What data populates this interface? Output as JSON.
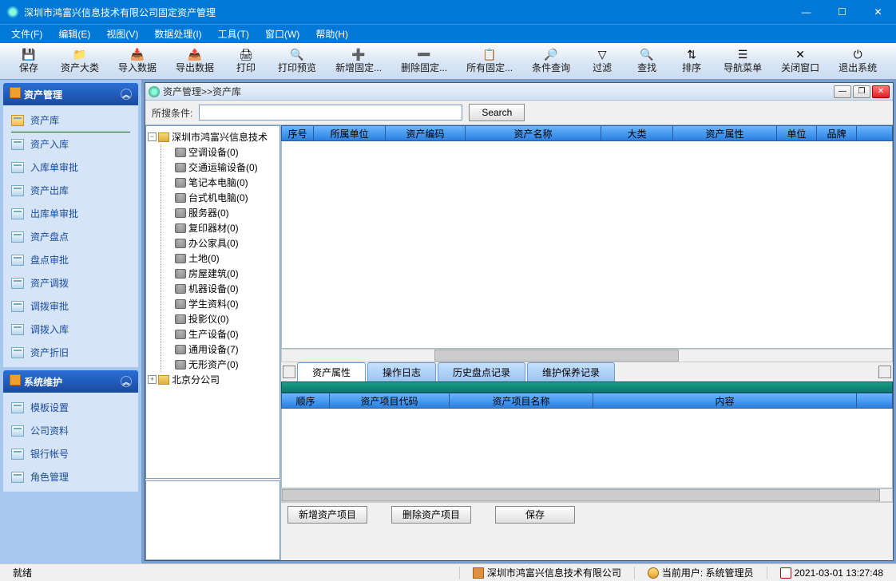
{
  "app": {
    "title": "深圳市鸿富兴信息技术有限公司固定资产管理"
  },
  "menu": [
    "文件(F)",
    "编辑(E)",
    "视图(V)",
    "数据处理(I)",
    "工具(T)",
    "窗口(W)",
    "帮助(H)"
  ],
  "toolbar": [
    {
      "label": "保存",
      "icon": "💾"
    },
    {
      "label": "资产大类",
      "icon": "📁"
    },
    {
      "label": "导入数据",
      "icon": "📥"
    },
    {
      "label": "导出数据",
      "icon": "📤"
    },
    {
      "label": "打印",
      "icon": "🖨"
    },
    {
      "label": "打印预览",
      "icon": "🔍"
    },
    {
      "label": "新增固定...",
      "icon": "➕"
    },
    {
      "label": "删除固定...",
      "icon": "➖"
    },
    {
      "label": "所有固定...",
      "icon": "📋"
    },
    {
      "label": "条件查询",
      "icon": "🔎"
    },
    {
      "label": "过滤",
      "icon": "▽"
    },
    {
      "label": "查找",
      "icon": "🔍"
    },
    {
      "label": "排序",
      "icon": "⇅"
    },
    {
      "label": "导航菜单",
      "icon": "☰"
    },
    {
      "label": "关闭窗口",
      "icon": "✕"
    },
    {
      "label": "退出系统",
      "icon": "⏻"
    }
  ],
  "sidebar": {
    "panels": [
      {
        "title": "资产管理",
        "items": [
          "资产库",
          "资产入库",
          "入库单审批",
          "资产出库",
          "出库单审批",
          "资产盘点",
          "盘点审批",
          "资产调拨",
          "调拨审批",
          "调拨入库",
          "资产折旧"
        ],
        "active": 0
      },
      {
        "title": "系统维护",
        "items": [
          "模板设置",
          "公司资料",
          "银行帐号",
          "角色管理"
        ]
      }
    ]
  },
  "subwindow": {
    "breadcrumb": "资产管理>>资产库",
    "search": {
      "label": "所搜条件:",
      "button": "Search"
    }
  },
  "tree": {
    "root": "深圳市鸿富兴信息技术",
    "children": [
      "空调设备(0)",
      "交通运输设备(0)",
      "笔记本电脑(0)",
      "台式机电脑(0)",
      "服务器(0)",
      "复印器材(0)",
      "办公家具(0)",
      "土地(0)",
      "房屋建筑(0)",
      "机器设备(0)",
      "学生资料(0)",
      "投影仪(0)",
      "生产设备(0)",
      "通用设备(7)",
      "无形资产(0)"
    ],
    "sibling": "北京分公司"
  },
  "grid": {
    "columns": [
      "序号",
      "所属单位",
      "资产编码",
      "资产名称",
      "大类",
      "资产属性",
      "单位",
      "品牌"
    ]
  },
  "tabs": [
    "资产属性",
    "操作日志",
    "历史盘点记录",
    "维护保养记录"
  ],
  "detail_columns": [
    "顺序",
    "资产项目代码",
    "资产项目名称",
    "内容"
  ],
  "bottom_buttons": [
    "新增资产项目",
    "删除资产项目",
    "保存"
  ],
  "status": {
    "ready": "就绪",
    "company": "深圳市鸿富兴信息技术有限公司",
    "user_label": "当前用户: 系统管理员",
    "datetime": "2021-03-01 13:27:48"
  }
}
